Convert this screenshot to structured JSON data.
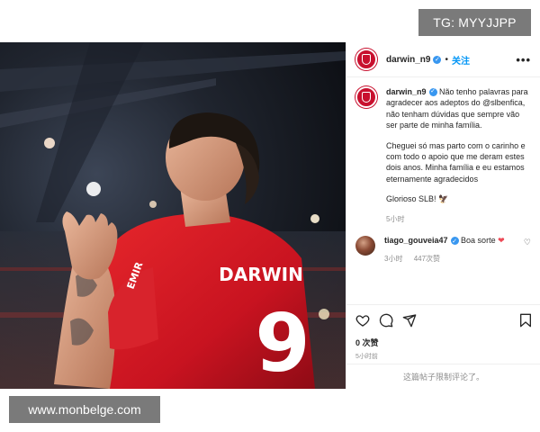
{
  "watermarks": {
    "top": "TG: MYYJJPP",
    "bottom": "www.monbelge.com"
  },
  "photo": {
    "jersey_name": "DARWIN",
    "jersey_number": "9",
    "sleeve_text": "EMIR"
  },
  "post": {
    "header": {
      "username": "darwin_n9",
      "separator": "•",
      "follow": "关注",
      "more": "•••"
    },
    "caption": {
      "username": "darwin_n9",
      "paragraphs": [
        "Não tenho palavras para agradecer aos adeptos do @slbenfica, não tenham dúvidas que sempre vão ser parte de minha família.",
        "Cheguei só mas parto com o carinho e com todo o apoio que me deram estes dois anos. Minha família e eu estamos eternamente agradecidos",
        "Glorioso SLB! 🦅"
      ],
      "time": "5小时"
    },
    "comment": {
      "username": "tiago_gouveia47",
      "text": "Boa sorte",
      "heart": "❤",
      "time": "3小时",
      "likes": "447次赞"
    },
    "likes_count": "0 次赞",
    "posted_ago": "5小时前",
    "comments_disabled": "这篇帖子限制评论了。",
    "icons": {
      "like": "heart-icon",
      "comment": "comment-icon",
      "share": "share-icon",
      "save": "bookmark-icon"
    },
    "colors": {
      "accent": "#0095f6",
      "benfica_red": "#c8102e",
      "verified": "#3897f0"
    }
  }
}
